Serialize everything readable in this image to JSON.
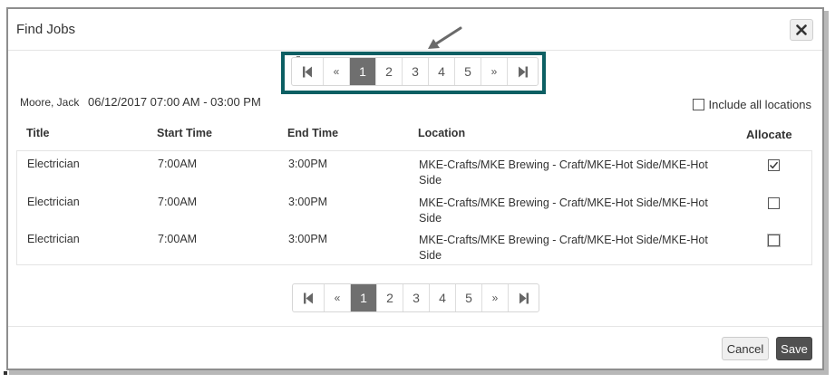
{
  "dialog": {
    "title": "Find Jobs",
    "close_icon": "close-icon"
  },
  "pagination": {
    "first_icon": "first-page-icon",
    "prev_label": "«",
    "pages": [
      "1",
      "2",
      "3",
      "4",
      "5"
    ],
    "active_page": "1",
    "next_label": "»",
    "last_icon": "last-page-icon"
  },
  "annotation": {
    "highlight_color": "#0c5f63",
    "arrow_icon": "arrow-pointer-icon"
  },
  "info": {
    "name": "Moore, Jack",
    "date_range": "06/12/2017 07:00 AM - 03:00 PM"
  },
  "include_all_locations": {
    "label": "Include all locations",
    "checked": false
  },
  "table": {
    "headers": [
      "Title",
      "Start Time",
      "End Time",
      "Location",
      "Allocate"
    ],
    "rows": [
      {
        "title": "Electrician",
        "start": "7:00AM",
        "end": "3:00PM",
        "location": "MKE-Crafts/MKE Brewing - Craft/MKE-Hot Side/MKE-Hot Side",
        "allocate": true
      },
      {
        "title": "Electrician",
        "start": "7:00AM",
        "end": "3:00PM",
        "location": "MKE-Crafts/MKE Brewing - Craft/MKE-Hot Side/MKE-Hot Side",
        "allocate": false
      },
      {
        "title": "Electrician",
        "start": "7:00AM",
        "end": "3:00PM",
        "location": "MKE-Crafts/MKE Brewing - Craft/MKE-Hot Side/MKE-Hot Side",
        "allocate": false
      }
    ]
  },
  "footer": {
    "cancel_label": "Cancel",
    "save_label": "Save"
  },
  "colors": {
    "active_page_bg": "#6f6f6f",
    "save_bg": "#505050"
  }
}
